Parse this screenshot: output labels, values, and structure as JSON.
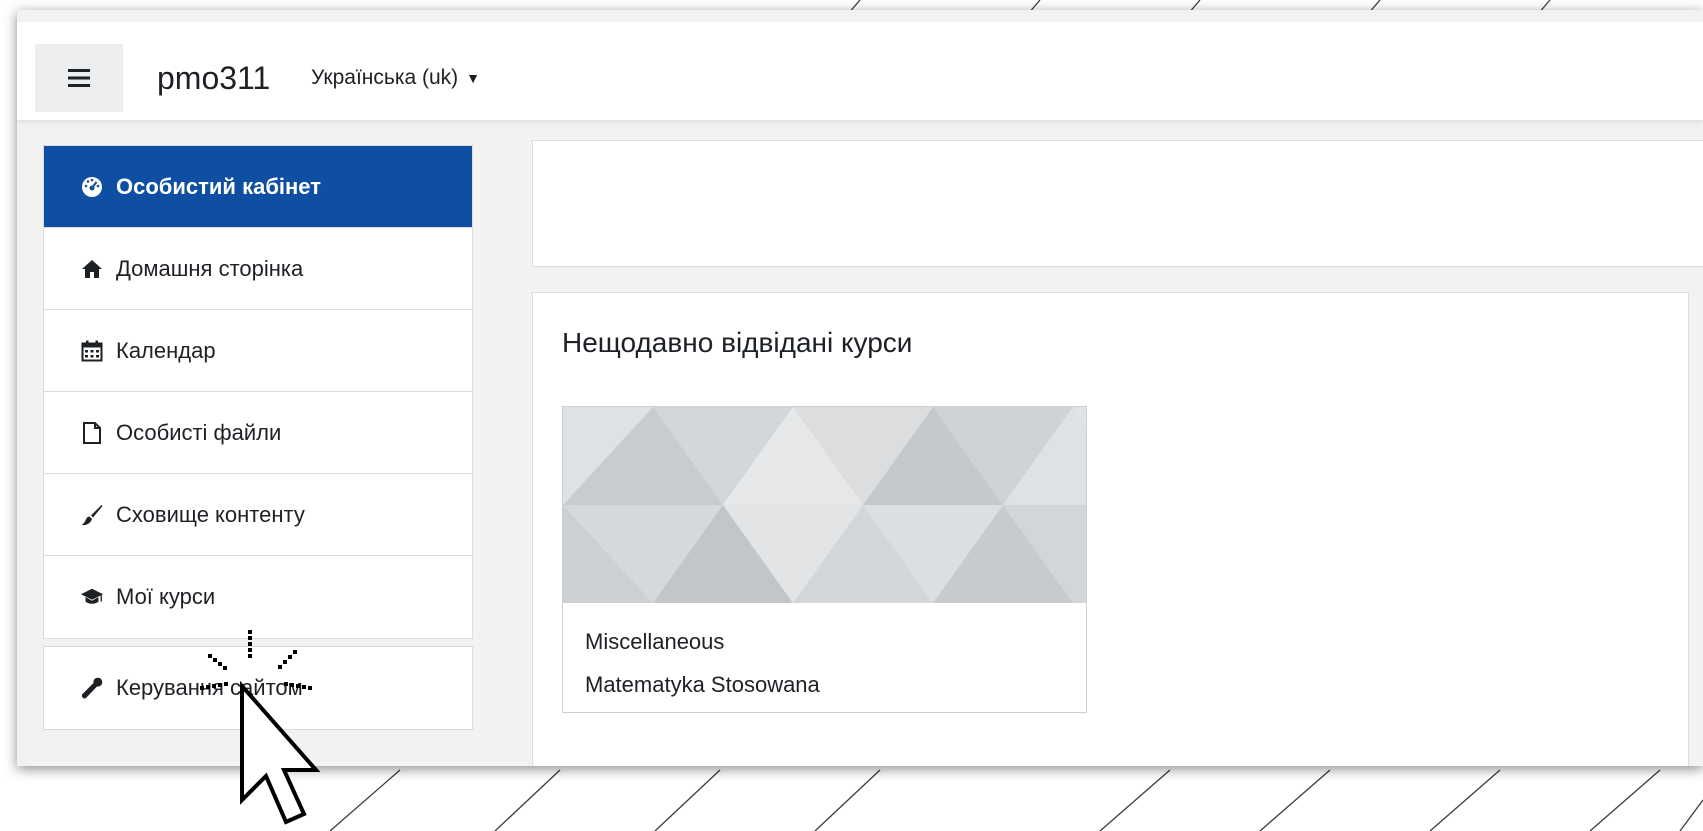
{
  "header": {
    "site_name": "pmo311",
    "language": "Українська (uk)"
  },
  "sidebar": {
    "items": [
      {
        "label": "Особистий кабінет",
        "icon": "dashboard-icon",
        "active": true
      },
      {
        "label": "Домашня сторінка",
        "icon": "home-icon"
      },
      {
        "label": "Календар",
        "icon": "calendar-icon"
      },
      {
        "label": "Особисті файли",
        "icon": "file-icon"
      },
      {
        "label": "Сховище контенту",
        "icon": "paintbrush-icon"
      },
      {
        "label": "Мої курси",
        "icon": "graduation-cap-icon"
      }
    ],
    "admin_item": {
      "label": "Керування сайтом",
      "icon": "wrench-icon"
    }
  },
  "main": {
    "recent_courses": {
      "title": "Нещодавно відвідані курси",
      "course": {
        "category": "Miscellaneous",
        "name": "Matematyka Stosowana"
      }
    }
  },
  "colors": {
    "active_item": "#0f4fa3",
    "page_background": "#f2f2f2"
  }
}
